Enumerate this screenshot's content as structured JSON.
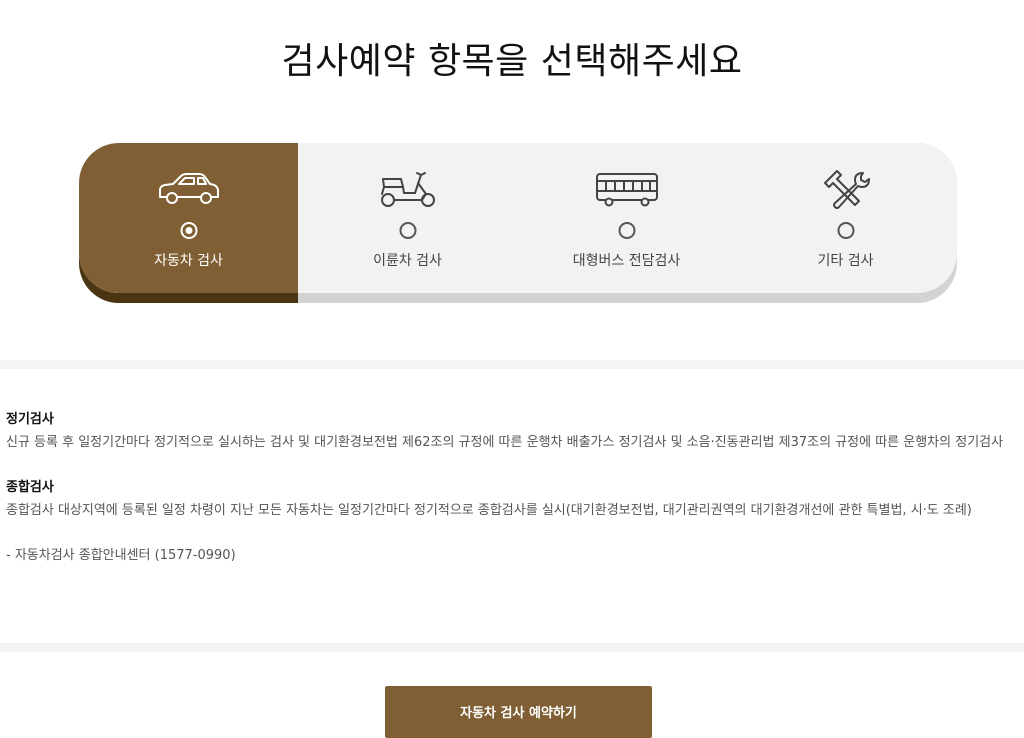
{
  "header": {
    "title": "검사예약 항목을 선택해주세요"
  },
  "selector": {
    "options": [
      {
        "label": "자동차 검사",
        "icon": "car-icon",
        "selected": true
      },
      {
        "label": "이륜차 검사",
        "icon": "scooter-icon",
        "selected": false
      },
      {
        "label": "대형버스 전담검사",
        "icon": "bus-icon",
        "selected": false
      },
      {
        "label": "기타 검사",
        "icon": "tools-icon",
        "selected": false
      }
    ]
  },
  "info": {
    "section1": {
      "title": "정기검사",
      "body": "신규 등록 후 일정기간마다 정기적으로 실시하는 검사 및 대기환경보전법 제62조의 규정에 따른 운행차 배출가스 정기검사 및 소음·진동관리법 제37조의 규정에 따른 운행차의 정기검사"
    },
    "section2": {
      "title": "종합검사",
      "body": "종합검사 대상지역에 등록된 일정 차령이 지난 모든 자동차는 일정기간마다 정기적으로 종합검사를 실시(대기환경보전법, 대기관리권역의 대기환경개선에 관한 특별법, 시·도 조례)"
    },
    "contact": "- 자동차검사 종합안내센터 (1577-0990)"
  },
  "action": {
    "button_label": "자동차 검사 예약하기"
  },
  "colors": {
    "accent": "#7f5f33",
    "accent_shadow": "#4a3512",
    "card_bg": "#f2f2f2"
  }
}
